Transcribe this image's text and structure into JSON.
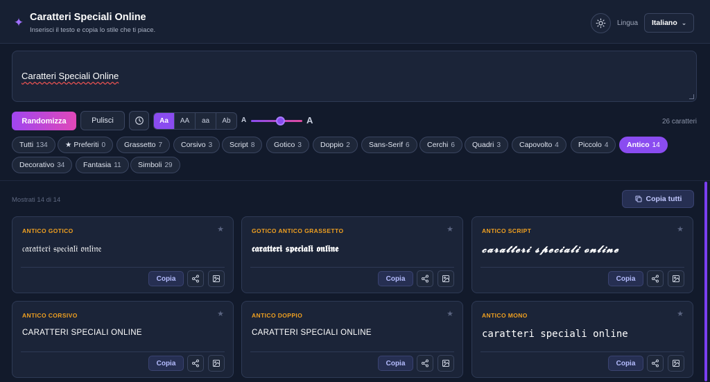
{
  "header": {
    "title": "Caratteri Speciali Online",
    "subtitle": "Inserisci il testo e copia lo stile che ti piace.",
    "language_label": "Lingua",
    "language_value": "Italiano"
  },
  "input": {
    "value": "Caratteri Speciali Online"
  },
  "toolbar": {
    "randomize_label": "Randomizza",
    "clear_label": "Pulisci",
    "case_options": [
      "Aa",
      "AA",
      "aa",
      "Ab"
    ],
    "case_selected": "Aa",
    "size_small_label": "A",
    "size_big_label": "A",
    "size_slider_value": 0.55,
    "char_count": "26 caratteri"
  },
  "categories": [
    {
      "label": "Tutti",
      "count": "134"
    },
    {
      "label": "★ Preferiti",
      "count": "0"
    },
    {
      "label": "Grassetto",
      "count": "7"
    },
    {
      "label": "Corsivo",
      "count": "3"
    },
    {
      "label": "Script",
      "count": "8"
    },
    {
      "label": "Gotico",
      "count": "3"
    },
    {
      "label": "Doppio",
      "count": "2"
    },
    {
      "label": "Sans-Serif",
      "count": "6"
    },
    {
      "label": "Cerchi",
      "count": "6"
    },
    {
      "label": "Quadri",
      "count": "3"
    },
    {
      "label": "Capovolto",
      "count": "4"
    },
    {
      "label": "Piccolo",
      "count": "4"
    },
    {
      "label": "Antico",
      "count": "14",
      "active": true
    },
    {
      "label": "Decorativo",
      "count": "34"
    },
    {
      "label": "Fantasia",
      "count": "11"
    },
    {
      "label": "Simboli",
      "count": "29"
    }
  ],
  "results": {
    "shown_text": "Mostrati 14 di 14",
    "copy_all_label": "Copia tutti",
    "copy_label": "Copia",
    "cards": [
      {
        "title": "ANTICO GOTICO",
        "preview": "𝔠𝔞𝔯𝔞𝔱𝔱𝔢𝔯𝔦 𝔰𝔭𝔢𝔠𝔦𝔞𝔩𝔦 𝔬𝔫𝔩𝔦𝔫𝔢"
      },
      {
        "title": "GOTICO ANTICO GRASSETTO",
        "preview": "𝖈𝖆𝖗𝖆𝖙𝖙𝖊𝖗𝖎 𝖘𝖕𝖊𝖈𝖎𝖆𝖑𝖎 𝖔𝖓𝖑𝖎𝖓𝖊"
      },
      {
        "title": "ANTICO SCRIPT",
        "preview": "𝓬𝓪𝓻𝓪𝓽𝓽𝓮𝓻𝓲 𝓼𝓹𝓮𝓬𝓲𝓪𝓵𝓲 𝓸𝓷𝓵𝓲𝓷𝓮"
      },
      {
        "title": "ANTICO CORSIVO",
        "preview": "CARATTERI SPECIALI ONLINE"
      },
      {
        "title": "ANTICO DOPPIO",
        "preview": "CARATTERI SPECIALI ONLINE"
      },
      {
        "title": "ANTICO MONO",
        "preview": "𝚌𝚊𝚛𝚊𝚝𝚝𝚎𝚛𝚒 𝚜𝚙𝚎𝚌𝚒𝚊𝚕𝚒 𝚘𝚗𝚕𝚒𝚗𝚎"
      }
    ]
  },
  "colors": {
    "accent": "#8a4cf0",
    "card_title": "#f0a020",
    "background": "#121a2b"
  },
  "icons": {
    "logo": "sparkle-icon",
    "theme": "sun-icon",
    "history": "clock-icon",
    "star": "star-icon",
    "share": "share-icon",
    "image": "image-icon",
    "copy_all": "copy-icon"
  }
}
